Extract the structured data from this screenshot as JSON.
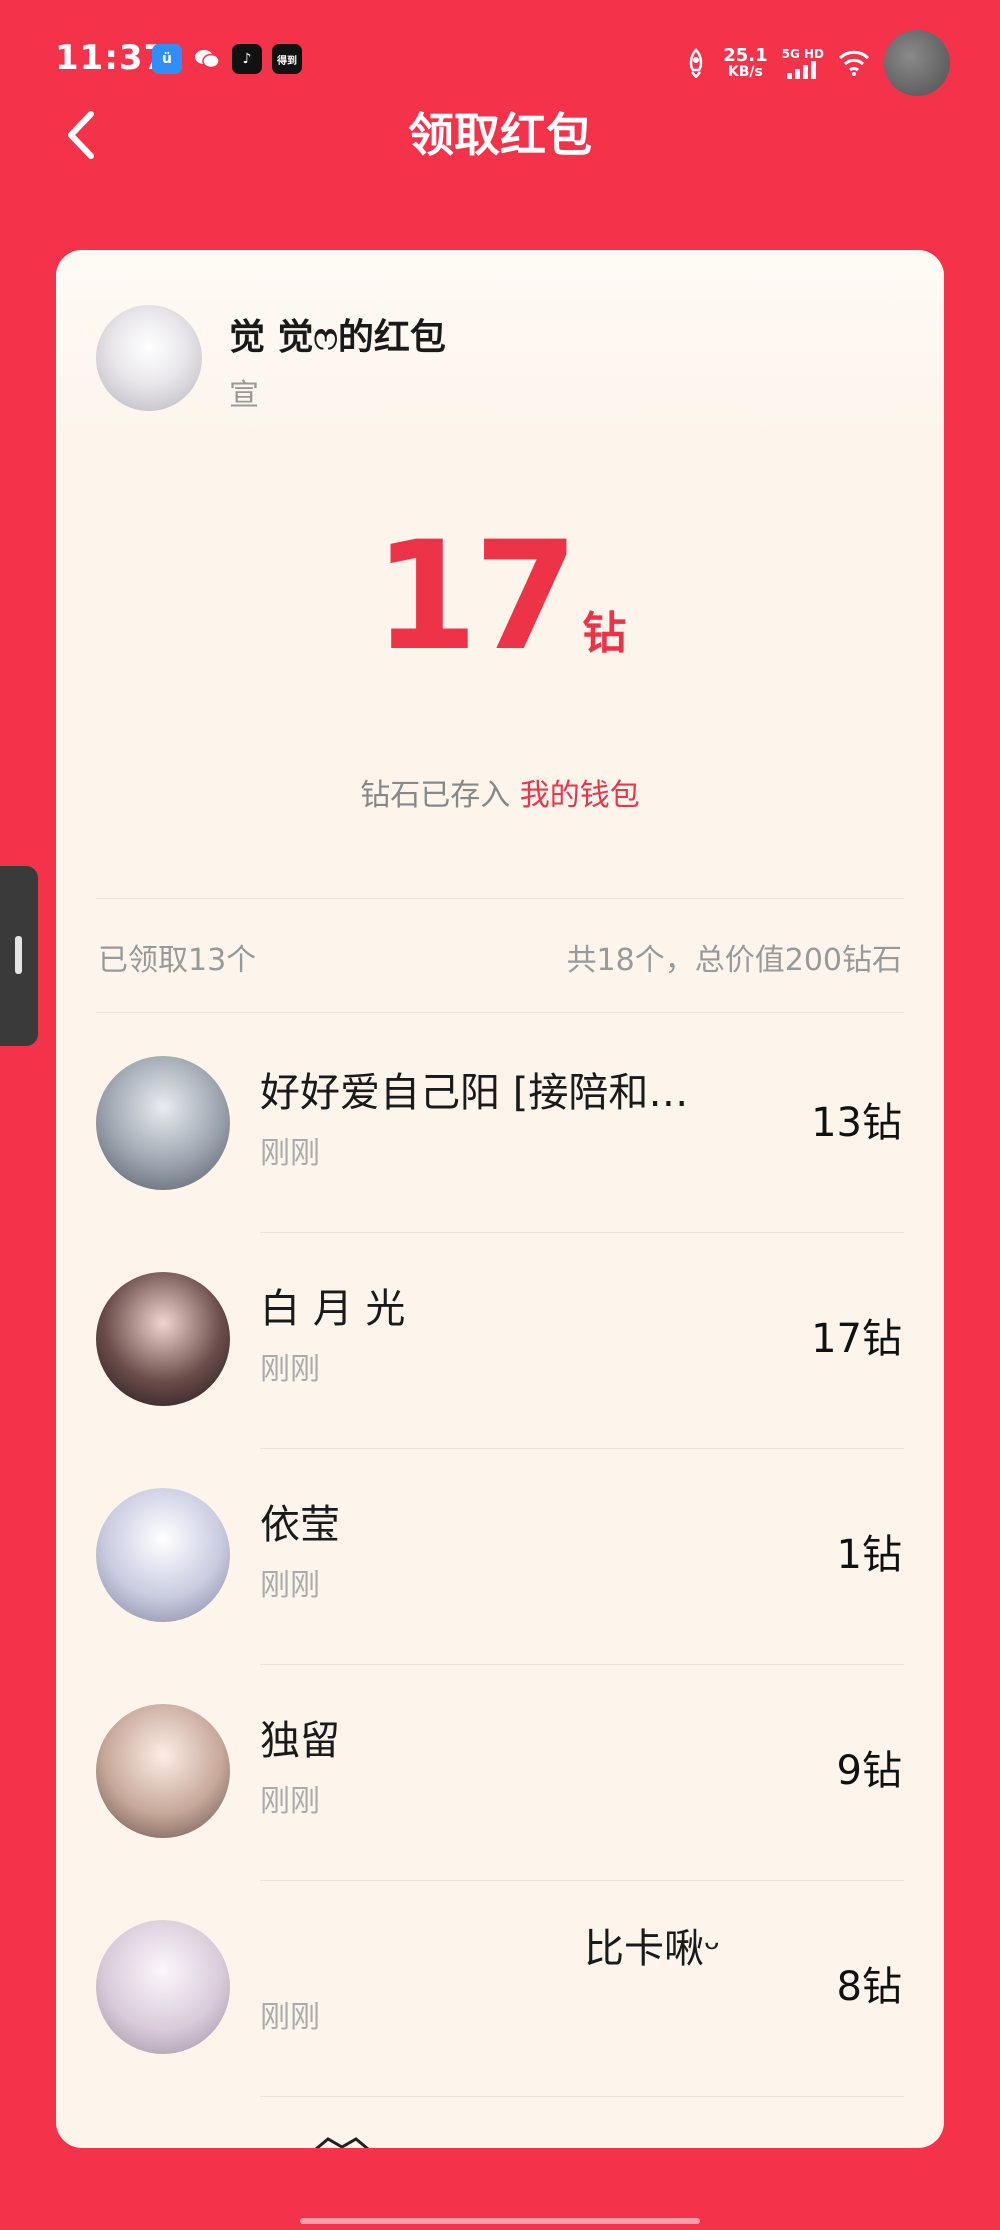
{
  "status_bar": {
    "time": "11:37",
    "app_icons": [
      {
        "icon": "smile-app-icon",
        "color": "#2f8ff7",
        "label": "ü"
      },
      {
        "icon": "wechat-icon",
        "color": "#f4334a",
        "label": ""
      },
      {
        "icon": "tiktok-icon",
        "color": "#111111",
        "label": "♪"
      },
      {
        "icon": "news-app-icon",
        "color": "#111111",
        "label": "得到"
      }
    ],
    "net_speed_value": "25.1",
    "net_speed_unit": "KB/s",
    "signal_label": "5G HD"
  },
  "nav": {
    "title": "领取红包"
  },
  "card": {
    "sender_title": "觉 觉ෆ的红包",
    "sender_sub": "宣",
    "amount": "17",
    "amount_unit": "钻",
    "wallet_prefix": "钻石已存入 ",
    "wallet_link": "我的钱包",
    "summary_left": "已领取13个",
    "summary_right": "共18个，总价值200钻石"
  },
  "receivers": [
    {
      "name": "好好爱自己阳 [接陪和…",
      "time": "刚刚",
      "amount": "13钻",
      "avatar_colors": [
        "#e9ecf0",
        "#9aa3ad",
        "#4f5662"
      ]
    },
    {
      "name": "白 月 光",
      "time": "刚刚",
      "amount": "17钻",
      "avatar_colors": [
        "#f2d4cf",
        "#6a4d4a",
        "#1c1518"
      ]
    },
    {
      "name": "依莹",
      "time": "刚刚",
      "amount": "1钻",
      "avatar_colors": [
        "#ffffff",
        "#c9cbe0",
        "#7c7f9a"
      ]
    },
    {
      "name": "独留",
      "time": "刚刚",
      "amount": "9钻",
      "avatar_colors": [
        "#fbeee6",
        "#c7a89a",
        "#5e4a44"
      ]
    },
    {
      "name": "比卡啾ᵕ",
      "time": "刚刚",
      "amount": "8钻",
      "avatar_colors": [
        "#fbf7fb",
        "#d9cbd9",
        "#9a8d9d"
      ]
    }
  ]
}
